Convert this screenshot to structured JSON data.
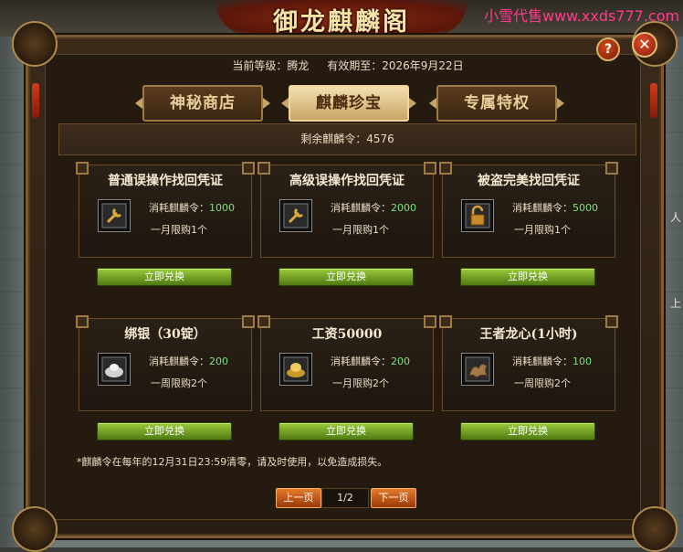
{
  "watermark": "小雪代售www.xxds777.com",
  "title": "御龙麒麟阁",
  "header": {
    "level_label": "当前等级：腾龙",
    "expire_label": "有效期至：2026年9月22日"
  },
  "tabs": [
    {
      "label": "神秘商店",
      "active": false
    },
    {
      "label": "麒麟珍宝",
      "active": true
    },
    {
      "label": "专属特权",
      "active": false
    }
  ],
  "remain": "剩余麒麟令：4576",
  "cards": [
    {
      "title": "普通误操作找回凭证",
      "cost_label": "消耗麒麟令：",
      "cost": "1000",
      "limit": "一月限购1个",
      "icon": "wrench-icon",
      "button": "立即兑换"
    },
    {
      "title": "高级误操作找回凭证",
      "cost_label": "消耗麒麟令：",
      "cost": "2000",
      "limit": "一月限购1个",
      "icon": "wrench-icon",
      "button": "立即兑换"
    },
    {
      "title": "被盗完美找回凭证",
      "cost_label": "消耗麒麟令：",
      "cost": "5000",
      "limit": "一月限购1个",
      "icon": "lock-icon",
      "button": "立即兑换"
    },
    {
      "title": "绑银（30锭）",
      "cost_label": "消耗麒麟令：",
      "cost": "200",
      "limit": "一周限购2个",
      "icon": "silver-ingot-icon",
      "button": "立即兑换"
    },
    {
      "title": "工资50000",
      "cost_label": "消耗麒麟令：",
      "cost": "200",
      "limit": "一月限购2个",
      "icon": "gold-ingot-icon",
      "button": "立即兑换"
    },
    {
      "title": "王者龙心(1小时)",
      "cost_label": "消耗麒麟令：",
      "cost": "100",
      "limit": "一周限购2个",
      "icon": "dragon-icon",
      "button": "立即兑换"
    }
  ],
  "note": "*麒麟令在每年的12月31日23:59清零，请及时使用，以免造成损失。",
  "pager": {
    "prev": "上一页",
    "page": "1/2",
    "next": "下一页"
  },
  "background_text": [
    "人",
    "上"
  ],
  "colors": {
    "accent_gold": "#c9a568",
    "button_green": "#6fa520",
    "cost_green": "#7fe07a",
    "pager_orange": "#d06a20"
  }
}
